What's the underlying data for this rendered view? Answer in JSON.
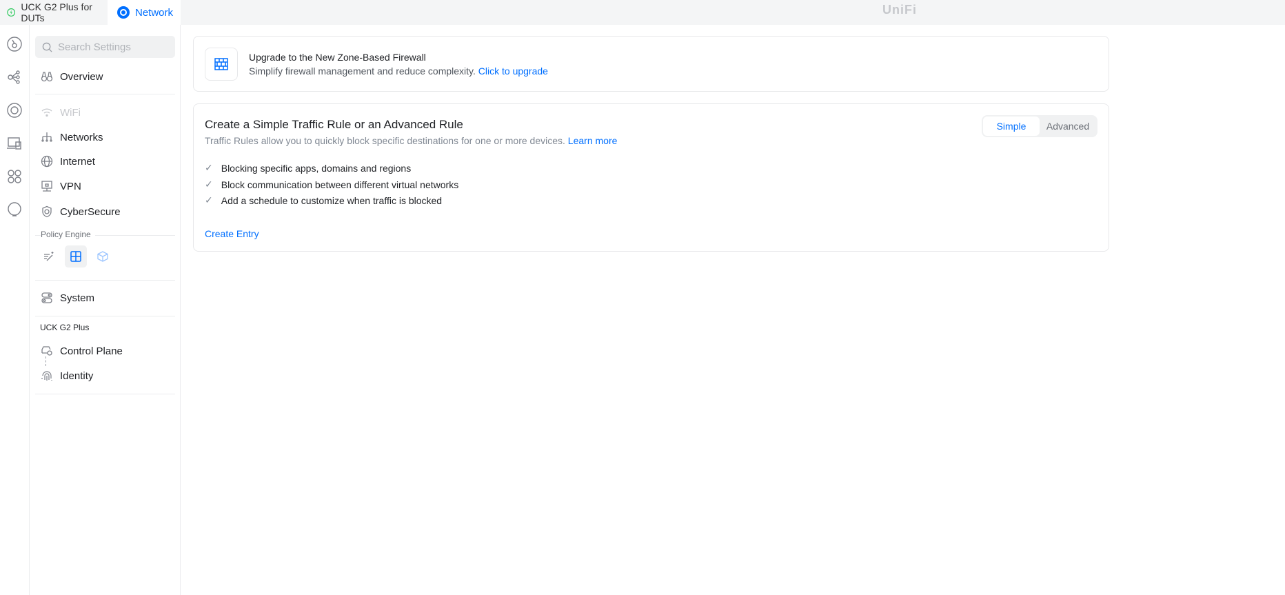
{
  "tabs": [
    {
      "label": "UCK G2 Plus for DUTs"
    },
    {
      "label": "Network"
    }
  ],
  "brand": "UniFi",
  "sidebar": {
    "search_placeholder": "Search Settings",
    "items": {
      "overview": "Overview",
      "wifi": "WiFi",
      "networks": "Networks",
      "internet": "Internet",
      "vpn": "VPN",
      "cybersecure": "CyberSecure",
      "system": "System",
      "control_plane": "Control Plane",
      "identity": "Identity"
    },
    "policy_engine_label": "Policy Engine",
    "device_section": "UCK G2 Plus"
  },
  "upgrade": {
    "title": "Upgrade to the New Zone-Based Firewall",
    "subtitle": "Simplify firewall management and reduce complexity.",
    "link": "Click to upgrade"
  },
  "rules": {
    "title": "Create a Simple Traffic Rule or an Advanced Rule",
    "subtitle": "Traffic Rules allow you to quickly block specific destinations for one or more devices.",
    "learn_more": "Learn more",
    "bullets": [
      "Blocking specific apps, domains and regions",
      "Block communication between different virtual networks",
      "Add a schedule to customize when traffic is blocked"
    ],
    "create": "Create Entry",
    "toggle": {
      "simple": "Simple",
      "advanced": "Advanced",
      "selected": "Simple"
    }
  },
  "colors": {
    "accent": "#006fff",
    "success": "#38cc65"
  }
}
